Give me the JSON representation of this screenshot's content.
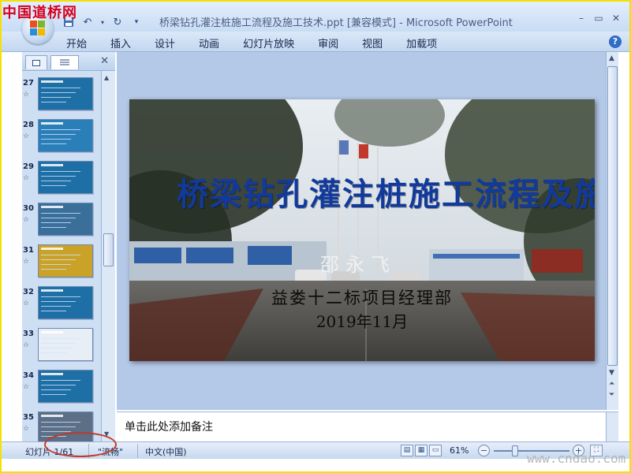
{
  "window": {
    "title": "桥梁钻孔灌注桩施工流程及施工技术.ppt [兼容模式] - Microsoft PowerPoint",
    "controls": [
      "–",
      "▭",
      "✕"
    ]
  },
  "watermarks": {
    "top": "中国道桥网",
    "bottom": "www.cndao.com"
  },
  "ribbon": {
    "tabs": [
      "开始",
      "插入",
      "设计",
      "动画",
      "幻灯片放映",
      "审阅",
      "视图",
      "加载项"
    ],
    "help": "?"
  },
  "qat_icons": [
    "save-icon",
    "undo-icon",
    "redo-icon",
    "customize-icon"
  ],
  "thumbnails": [
    {
      "num": "27",
      "color": "#1d6fa5"
    },
    {
      "num": "28",
      "color": "#2a7fb8"
    },
    {
      "num": "29",
      "color": "#1d6fa5"
    },
    {
      "num": "30",
      "color": "#3a6f9a"
    },
    {
      "num": "31",
      "color": "#c9a227"
    },
    {
      "num": "32",
      "color": "#1d6fa5"
    },
    {
      "num": "33",
      "color": "#e8eef5"
    },
    {
      "num": "34",
      "color": "#1d6fa5"
    },
    {
      "num": "35",
      "color": "#5b6f86"
    }
  ],
  "slide": {
    "title": "桥梁钻孔灌注桩施工流程及施工技术",
    "author": "邵永飞",
    "org": "益娄十二标项目经理部",
    "date": "2019年11月"
  },
  "notes": {
    "placeholder": "单击此处添加备注"
  },
  "status": {
    "slide_info": "幻灯片 1/61",
    "theme": "\"流畅\"",
    "language": "中文(中国)",
    "zoom": "61%",
    "zoom_level": 0.61
  }
}
